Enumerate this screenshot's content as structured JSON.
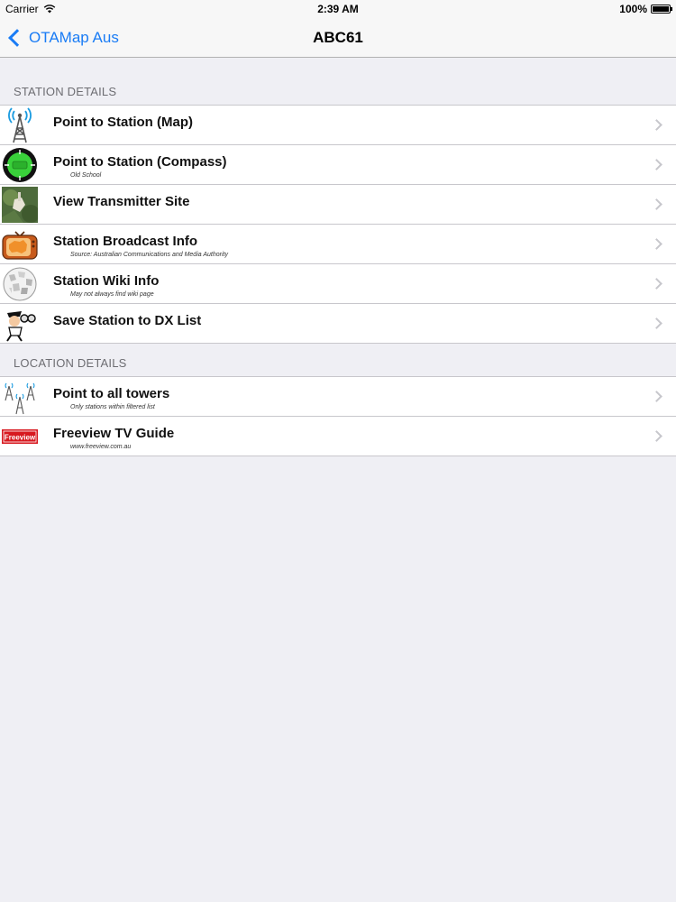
{
  "status_bar": {
    "carrier": "Carrier",
    "time": "2:39 AM",
    "battery": "100%",
    "battery_level": 1.0
  },
  "nav": {
    "back_label": "OTAMap Aus",
    "title": "ABC61"
  },
  "sections": [
    {
      "header": "STATION DETAILS",
      "rows": [
        {
          "title": "Point to Station (Map)",
          "subtitle": "",
          "icon": "transmitter-tower-icon"
        },
        {
          "title": "Point to Station (Compass)",
          "subtitle": "Old School",
          "icon": "compass-icon"
        },
        {
          "title": "View Transmitter Site",
          "subtitle": "",
          "icon": "site-photo-icon"
        },
        {
          "title": "Station Broadcast Info",
          "subtitle": "Source: Australian Communications and Media Authority",
          "icon": "tv-australia-icon"
        },
        {
          "title": "Station Wiki Info",
          "subtitle": "May not always find wiki page",
          "icon": "wikipedia-globe-icon"
        },
        {
          "title": "Save Station to DX List",
          "subtitle": "",
          "icon": "binoculars-spy-icon"
        }
      ]
    },
    {
      "header": "LOCATION DETAILS",
      "rows": [
        {
          "title": "Point to all towers",
          "subtitle": "Only stations within filtered list",
          "icon": "multiple-towers-icon"
        },
        {
          "title": "Freeview TV Guide",
          "subtitle": "www.freeview.com.au",
          "icon": "freeview-logo-icon",
          "logo_text": "Freeview"
        }
      ]
    }
  ],
  "colors": {
    "accent": "#1a7cf5",
    "background": "#efeff4",
    "separator": "#c8c7cc"
  }
}
